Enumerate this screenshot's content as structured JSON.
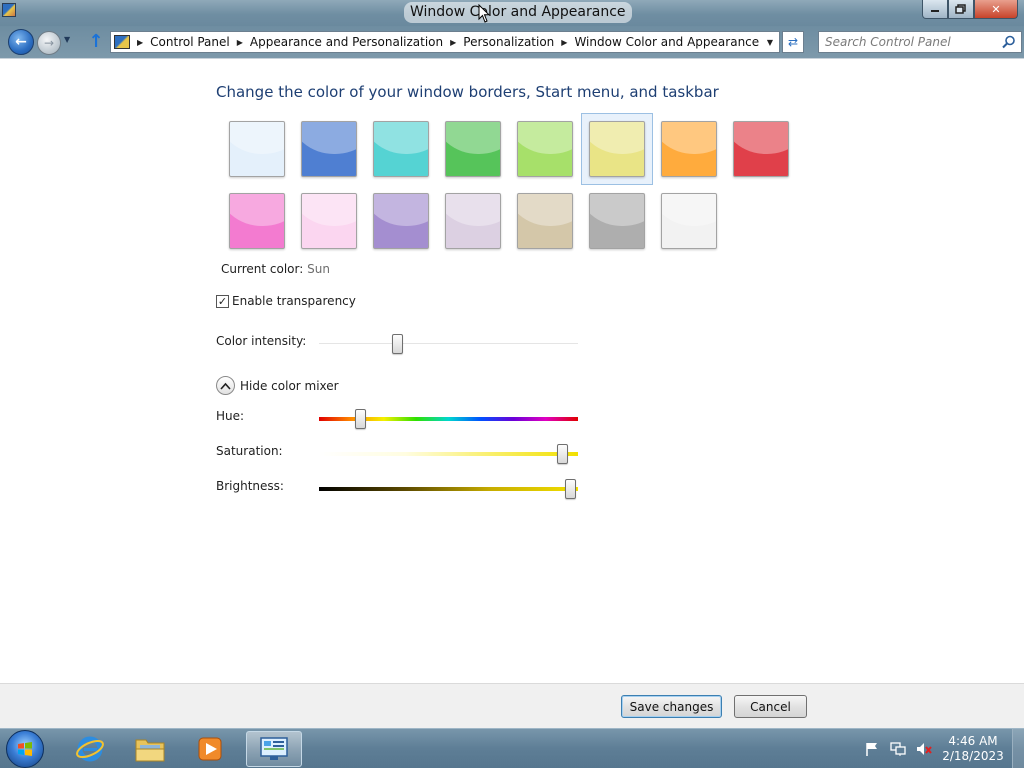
{
  "window": {
    "title": "Window Color and Appearance"
  },
  "nav": {
    "breadcrumbs": [
      "Control Panel",
      "Appearance and Personalization",
      "Personalization",
      "Window Color and Appearance"
    ],
    "search_placeholder": "Search Control Panel"
  },
  "content": {
    "heading": "Change the color of your window borders, Start menu, and taskbar",
    "swatches": [
      {
        "color": "#e4f0fb",
        "selected": false
      },
      {
        "color": "#4f7fd2",
        "selected": false
      },
      {
        "color": "#55d3d3",
        "selected": false
      },
      {
        "color": "#56c45a",
        "selected": false
      },
      {
        "color": "#a7e06a",
        "selected": false
      },
      {
        "color": "#e9e486",
        "selected": true
      },
      {
        "color": "#ffab3d",
        "selected": false
      },
      {
        "color": "#e0404a",
        "selected": false
      },
      {
        "color": "#f37bd0",
        "selected": false
      },
      {
        "color": "#fbd6f0",
        "selected": false
      },
      {
        "color": "#a48ed0",
        "selected": false
      },
      {
        "color": "#dcd0e2",
        "selected": false
      },
      {
        "color": "#d4c7a9",
        "selected": false
      },
      {
        "color": "#aeaeae",
        "selected": false
      },
      {
        "color": "#f2f2f2",
        "selected": false
      }
    ],
    "current_color_label": "Current color:",
    "current_color_value": "Sun",
    "transparency_label": "Enable transparency",
    "transparency_checked": true,
    "intensity_label": "Color intensity:",
    "intensity_value": 0.3,
    "mixer_label": "Hide color mixer",
    "hue_label": "Hue:",
    "hue_value": 0.16,
    "saturation_label": "Saturation:",
    "saturation_value": 0.94,
    "brightness_label": "Brightness:",
    "brightness_value": 0.97
  },
  "footer": {
    "save_label": "Save changes",
    "cancel_label": "Cancel"
  },
  "taskbar": {
    "time": "4:46 AM",
    "date": "2/18/2023",
    "pinned": [
      "internet-explorer-icon",
      "folder-icon",
      "media-player-icon",
      "control-panel-icon"
    ]
  }
}
